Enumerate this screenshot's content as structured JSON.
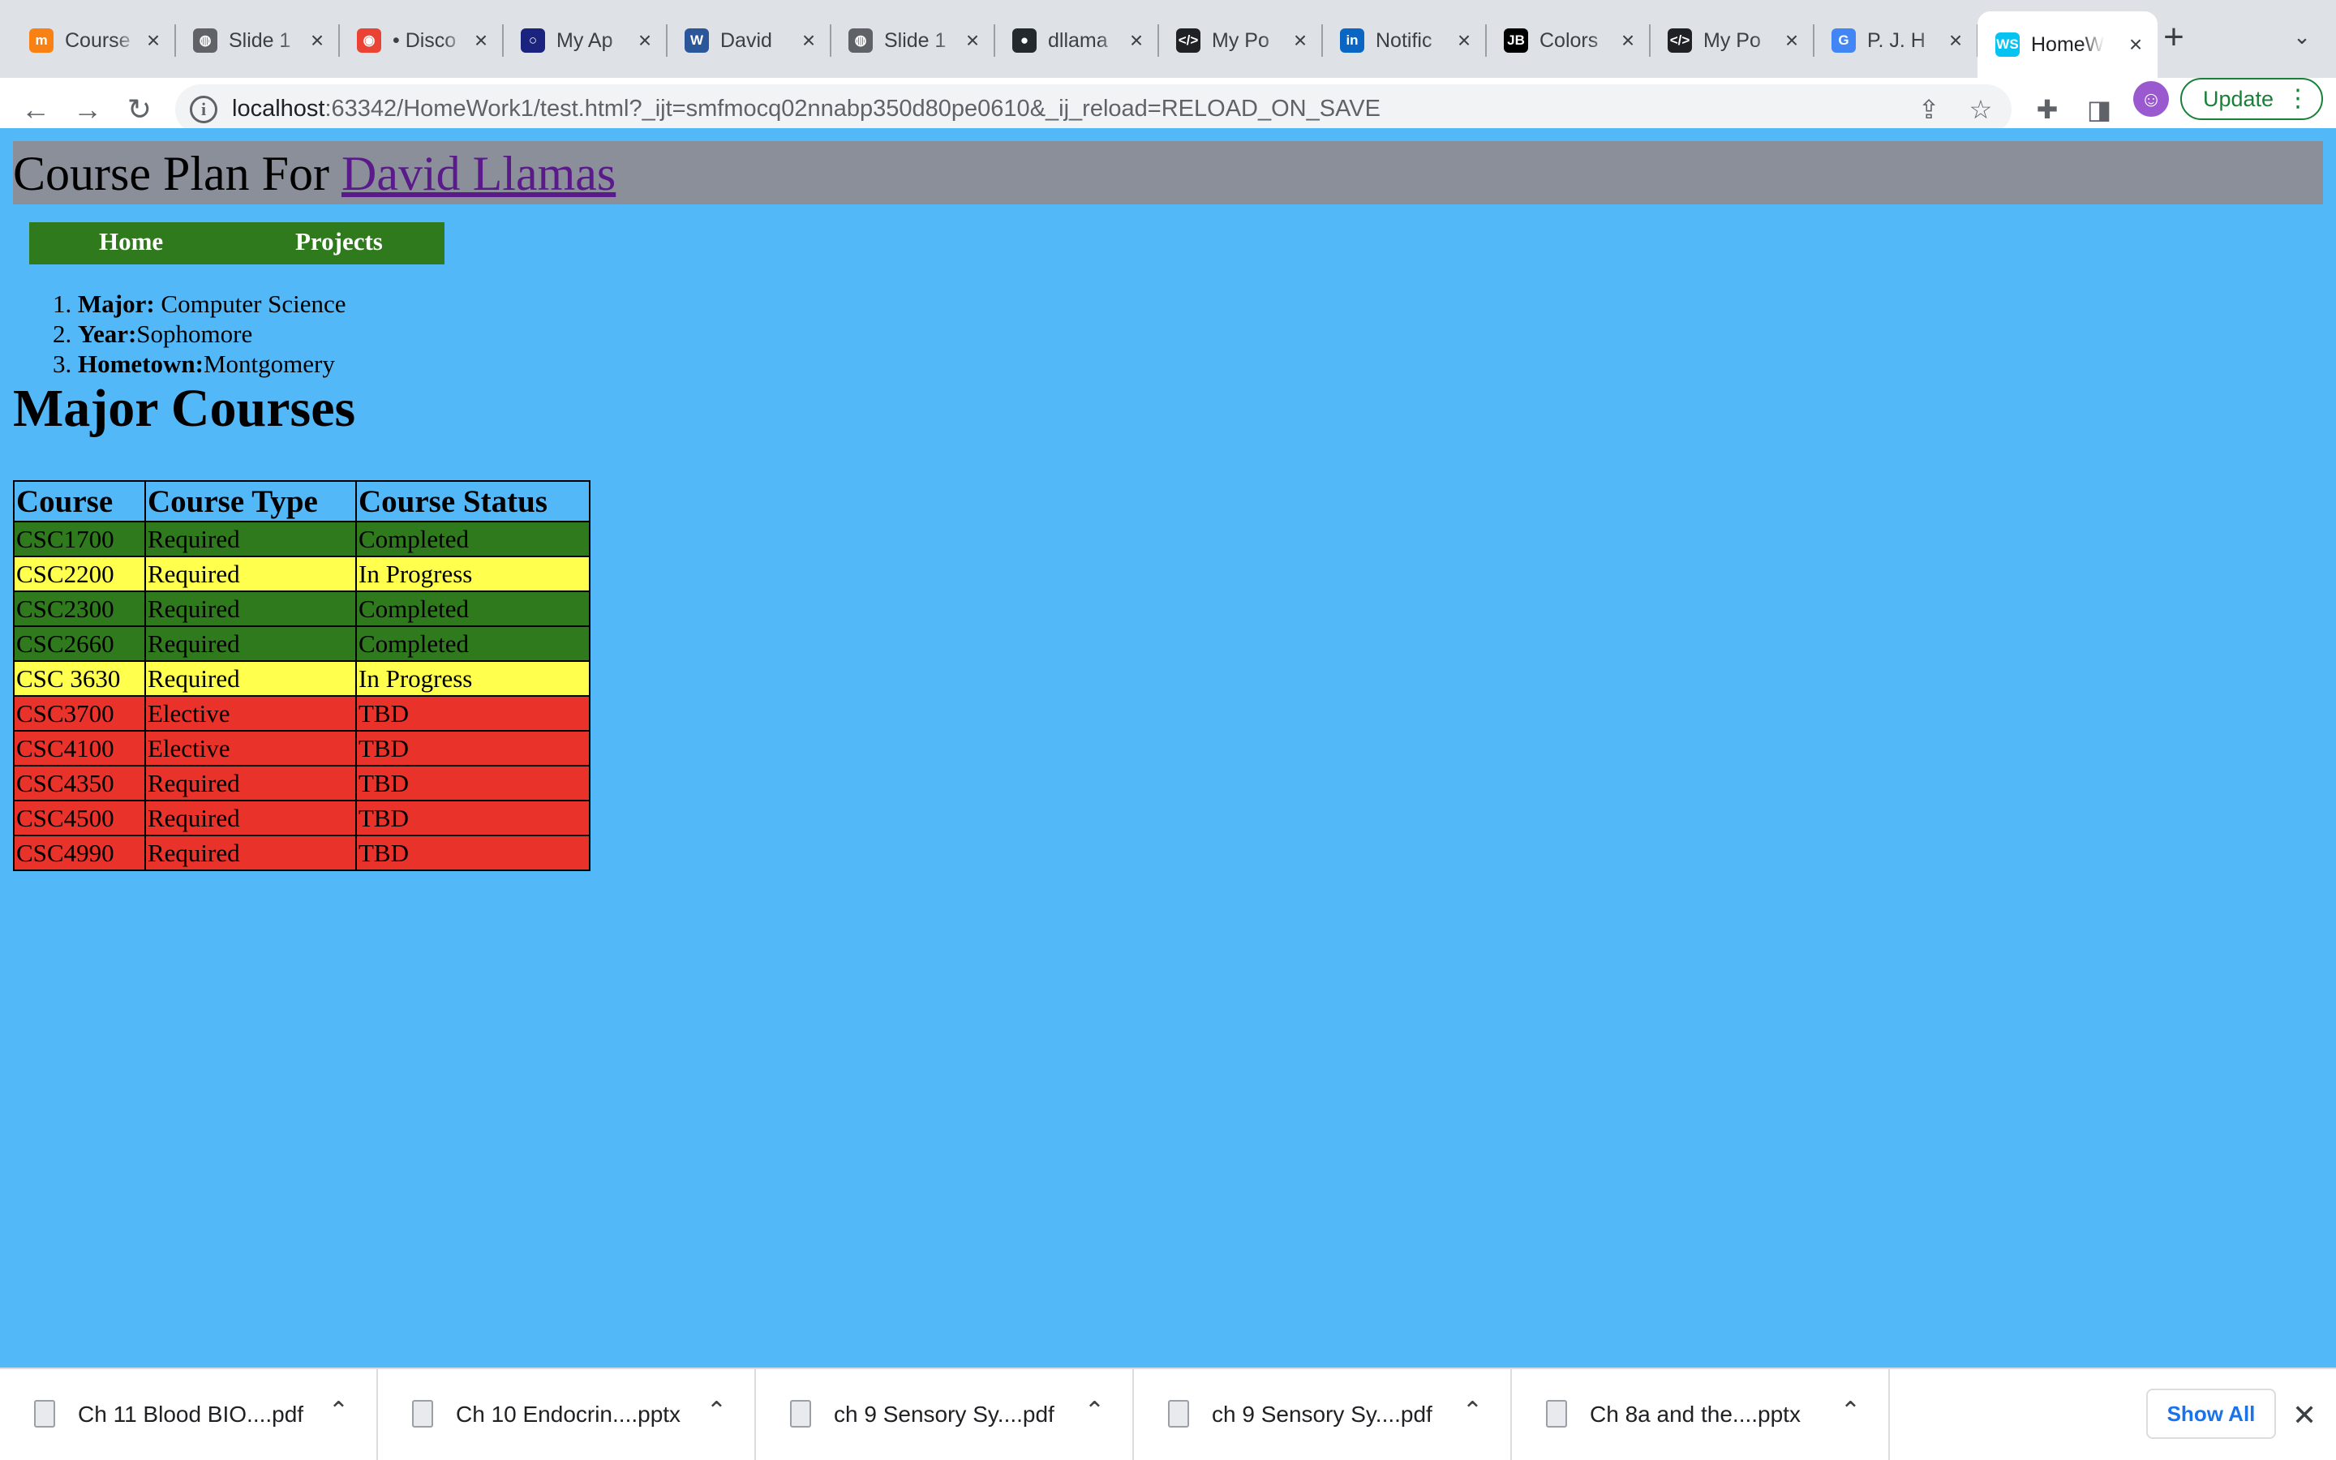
{
  "browser": {
    "tabs": [
      {
        "title": "Course",
        "icon": "moodle-icon",
        "glyph": "m",
        "color": "#f98012"
      },
      {
        "title": "Slide 1",
        "icon": "globe-icon",
        "glyph": "◍",
        "color": "#5f6368"
      },
      {
        "title": "• Disco",
        "icon": "discord-icon",
        "glyph": "◉",
        "color": "#ea4335"
      },
      {
        "title": "My Ap",
        "icon": "app-icon",
        "glyph": "○",
        "color": "#1a237e"
      },
      {
        "title": "David",
        "icon": "word-icon",
        "glyph": "W",
        "color": "#2b579a"
      },
      {
        "title": "Slide 1",
        "icon": "globe-icon",
        "glyph": "◍",
        "color": "#5f6368"
      },
      {
        "title": "dllama",
        "icon": "github-icon",
        "glyph": "●",
        "color": "#24292e"
      },
      {
        "title": "My Po",
        "icon": "code-icon",
        "glyph": "</>",
        "color": "#202124"
      },
      {
        "title": "Notific",
        "icon": "linkedin-icon",
        "glyph": "in",
        "color": "#0a66c2"
      },
      {
        "title": "Colors",
        "icon": "jetbrains-icon",
        "glyph": "JB",
        "color": "#000000"
      },
      {
        "title": "My Po",
        "icon": "code-icon",
        "glyph": "</>",
        "color": "#202124"
      },
      {
        "title": "P. J. H",
        "icon": "google-icon",
        "glyph": "G",
        "color": "#4285f4"
      },
      {
        "title": "HomeW",
        "icon": "webstorm-icon",
        "glyph": "WS",
        "color": "#07c3f2",
        "active": true
      }
    ],
    "url_host": "localhost",
    "url_rest": ":63342/HomeWork1/test.html?_ijt=smfmocq02nnabp350d80pe0610&_ij_reload=RELOAD_ON_SAVE",
    "update_label": "Update"
  },
  "page": {
    "title_prefix": "Course Plan For ",
    "title_link": "David Llamas",
    "nav": [
      "Home",
      "Projects"
    ],
    "info": [
      {
        "label": "Major:",
        "value": " Computer Science"
      },
      {
        "label": "Year:",
        "value": "Sophomore"
      },
      {
        "label": "Hometown:",
        "value": "Montgomery"
      }
    ],
    "section_heading": "Major Courses",
    "table": {
      "headers": [
        "Course",
        "Course Type",
        "Course Status"
      ],
      "rows": [
        {
          "course": "CSC1700",
          "type": "Required",
          "status": "Completed",
          "state": "done"
        },
        {
          "course": "CSC2200",
          "type": "Required",
          "status": "In Progress",
          "state": "prog"
        },
        {
          "course": "CSC2300",
          "type": "Required",
          "status": "Completed",
          "state": "done"
        },
        {
          "course": "CSC2660",
          "type": "Required",
          "status": "Completed",
          "state": "done"
        },
        {
          "course": "CSC 3630",
          "type": "Required",
          "status": "In Progress",
          "state": "prog"
        },
        {
          "course": "CSC3700",
          "type": "Elective",
          "status": "TBD",
          "state": "tbd"
        },
        {
          "course": "CSC4100",
          "type": "Elective",
          "status": "TBD",
          "state": "tbd"
        },
        {
          "course": "CSC4350",
          "type": "Required",
          "status": "TBD",
          "state": "tbd"
        },
        {
          "course": "CSC4500",
          "type": "Required",
          "status": "TBD",
          "state": "tbd"
        },
        {
          "course": "CSC4990",
          "type": "Required",
          "status": "TBD",
          "state": "tbd"
        }
      ]
    }
  },
  "downloads": {
    "items": [
      "Ch 11 Blood BIO....pdf",
      "Ch 10 Endocrin....pptx",
      "ch 9 Sensory Sy....pdf",
      "ch 9 Sensory Sy....pdf",
      "Ch 8a and the....pptx"
    ],
    "show_all": "Show All"
  },
  "colors": {
    "page_bg": "#53b8f8",
    "banner_bg": "#8a8f9a",
    "nav_bg": "#2f7a1d",
    "completed": "#2f7a1d",
    "in_progress": "#ffff4d",
    "tbd": "#e8322a"
  }
}
